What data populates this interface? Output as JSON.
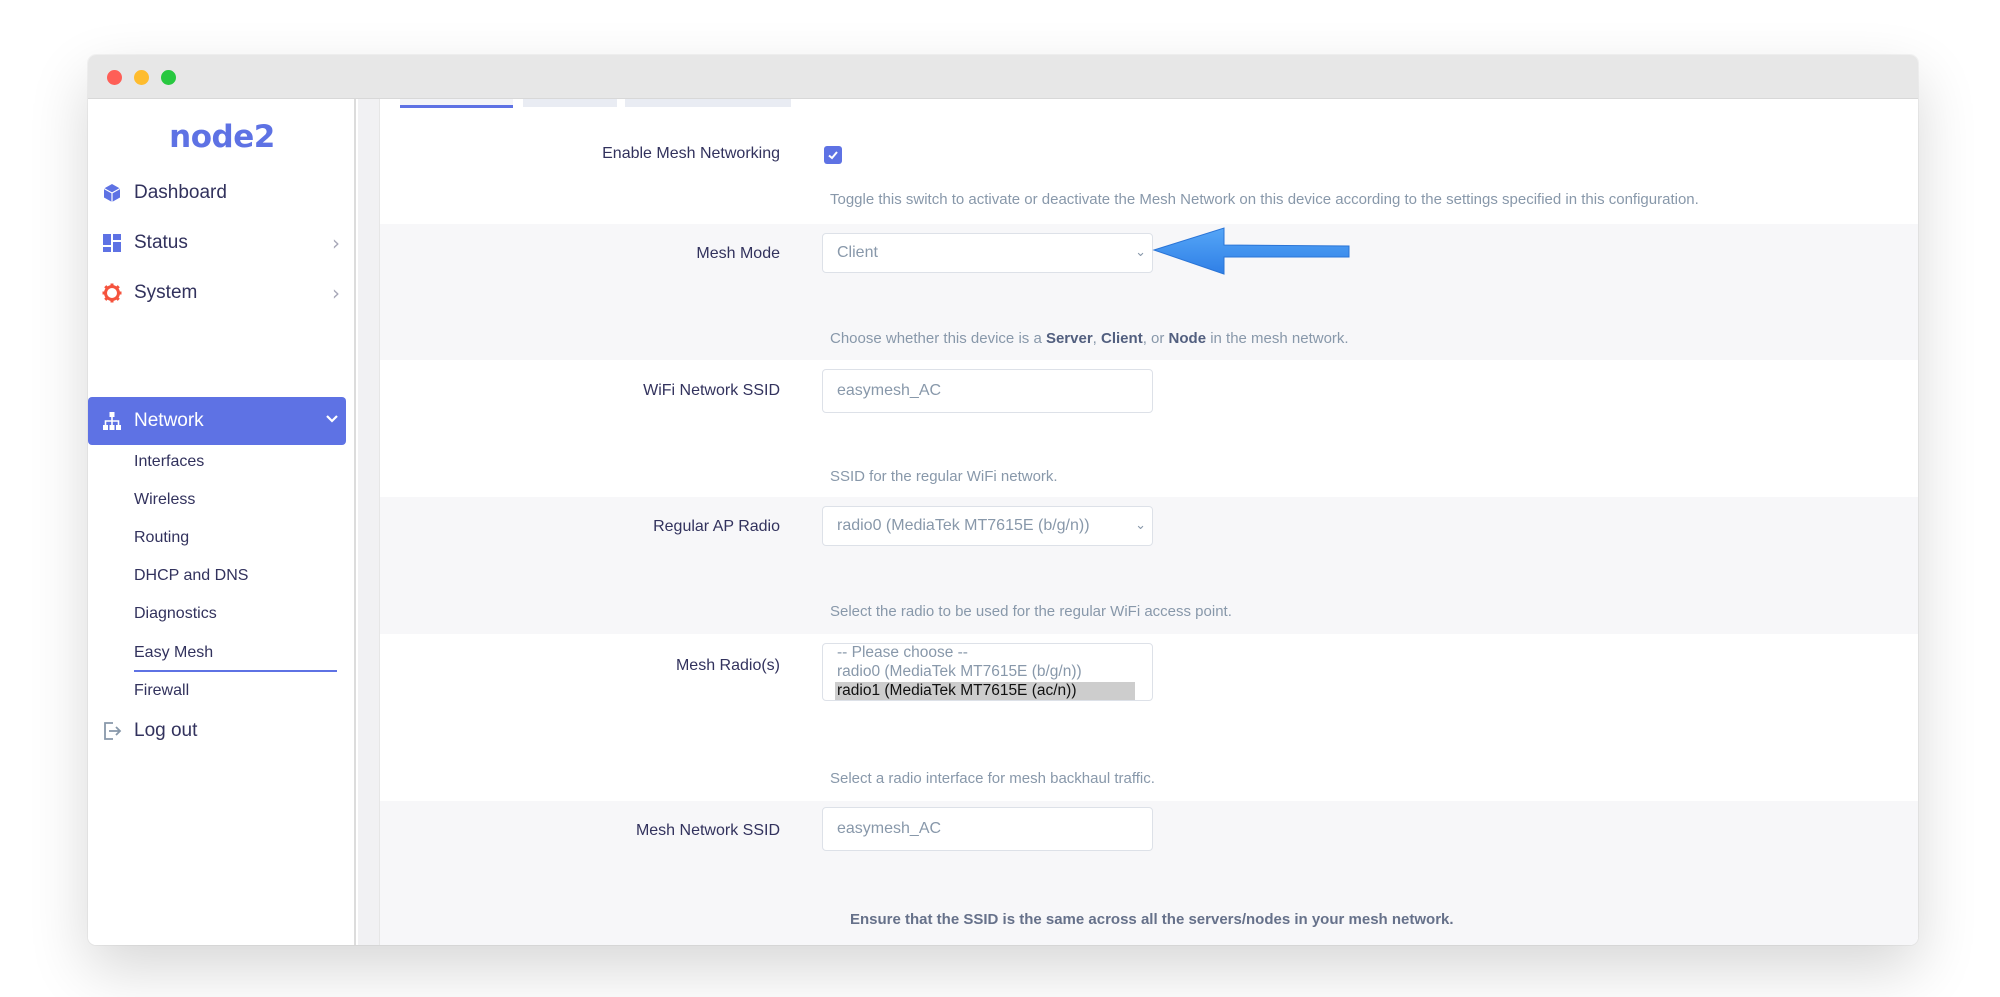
{
  "app": {
    "logo": "node2"
  },
  "sidebar": {
    "items": [
      {
        "label": "Dashboard",
        "icon": "cube-icon",
        "chevron": ""
      },
      {
        "label": "Status",
        "icon": "dashboard-grid-icon",
        "chevron": "›"
      },
      {
        "label": "System",
        "icon": "gear-icon",
        "chevron": "›"
      },
      {
        "label": "Network",
        "icon": "network-tree-icon",
        "chevron": "⌄",
        "active": true
      }
    ],
    "network_sub": [
      "Interfaces",
      "Wireless",
      "Routing",
      "DHCP and DNS",
      "Diagnostics",
      "Easy Mesh",
      "Firewall"
    ],
    "active_sub": "Easy Mesh",
    "logout": {
      "label": "Log out",
      "icon": "logout-icon"
    }
  },
  "form": {
    "enable_mesh": {
      "label": "Enable Mesh Networking",
      "checked": true,
      "description": "Toggle this switch to activate or deactivate the Mesh Network on this device according to the settings specified in this configuration."
    },
    "mesh_mode": {
      "label": "Mesh Mode",
      "value": "Client",
      "desc_prefix": "Choose whether this device is a ",
      "desc_server": "Server",
      "desc_sep1": ", ",
      "desc_client": "Client",
      "desc_sep2": ", or ",
      "desc_node": "Node",
      "desc_suffix": " in the mesh network."
    },
    "wifi_ssid": {
      "label": "WiFi Network SSID",
      "placeholder": "easymesh_AC",
      "description": "SSID for the regular WiFi network."
    },
    "ap_radio": {
      "label": "Regular AP Radio",
      "value": "radio0 (MediaTek MT7615E (b/g/n))",
      "description": "Select the radio to be used for the regular WiFi access point."
    },
    "mesh_radios": {
      "label": "Mesh Radio(s)",
      "options": [
        "-- Please choose --",
        "radio0 (MediaTek MT7615E (b/g/n))",
        "radio1 (MediaTek MT7615E (ac/n))"
      ],
      "selected_index": 2,
      "description": "Select a radio interface for mesh backhaul traffic."
    },
    "mesh_ssid": {
      "label": "Mesh Network SSID",
      "placeholder": "easymesh_AC",
      "description": "Ensure that the SSID is the same across all the servers/nodes in your mesh network."
    }
  },
  "colors": {
    "accent": "#5e72e4",
    "arrow": "#3d8ff0"
  }
}
